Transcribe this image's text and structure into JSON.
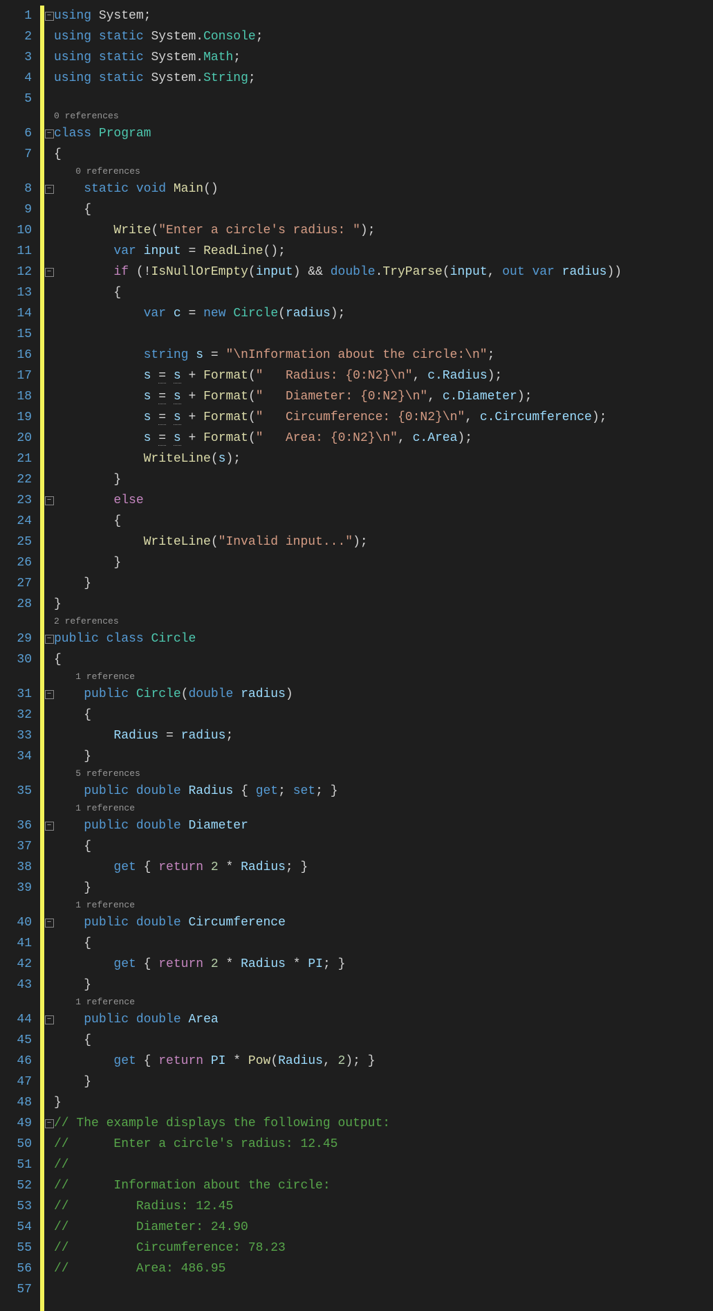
{
  "line_numbers": [
    "1",
    "2",
    "3",
    "4",
    "5",
    "",
    "6",
    "7",
    "",
    "8",
    "9",
    "10",
    "11",
    "12",
    "13",
    "14",
    "15",
    "16",
    "17",
    "18",
    "19",
    "20",
    "21",
    "22",
    "23",
    "24",
    "25",
    "26",
    "27",
    "28",
    "",
    "29",
    "30",
    "",
    "31",
    "32",
    "33",
    "34",
    "",
    "35",
    "",
    "36",
    "37",
    "38",
    "39",
    "",
    "40",
    "41",
    "42",
    "43",
    "",
    "44",
    "45",
    "46",
    "47",
    "48",
    "49",
    "50",
    "51",
    "52",
    "53",
    "54",
    "55",
    "56",
    "57"
  ],
  "codelens": {
    "class_program": "0 references",
    "main": "0 references",
    "class_circle": "2 references",
    "ctor": "1 reference",
    "radius_prop": "5 references",
    "diameter": "1 reference",
    "circ": "1 reference",
    "area": "1 reference"
  },
  "fold_markers": {
    "l1": "−",
    "l6": "−",
    "l8": "−",
    "l12": "−",
    "l23": "−",
    "l29": "−",
    "l31": "−",
    "l36": "−",
    "l40": "−",
    "l44": "−",
    "l49": "−"
  },
  "code": {
    "l1": {
      "kw1": "using",
      "sp1": " ",
      "ns1": "System",
      "semi": ";"
    },
    "l2": {
      "kw1": "using",
      "sp1": " ",
      "kw2": "static",
      "sp2": " ",
      "ns1": "System.",
      "cls": "Console",
      "semi": ";"
    },
    "l3": {
      "kw1": "using",
      "sp1": " ",
      "kw2": "static",
      "sp2": " ",
      "ns1": "System.",
      "cls": "Math",
      "semi": ";"
    },
    "l4": {
      "kw1": "using",
      "sp1": " ",
      "kw2": "static",
      "sp2": " ",
      "ns1": "System.",
      "cls": "String",
      "semi": ";"
    },
    "l6": {
      "kw1": "class",
      "sp1": " ",
      "cls": "Program"
    },
    "l7": {
      "brace": "{"
    },
    "l8": {
      "indent": "    ",
      "kw1": "static",
      "sp1": " ",
      "kw2": "void",
      "sp2": " ",
      "fn": "Main",
      "paren": "()"
    },
    "l9": {
      "indent": "    ",
      "brace": "{"
    },
    "l10": {
      "indent": "        ",
      "fn": "Write",
      "p1": "(",
      "str": "\"Enter a circle's radius: \"",
      "p2": ");"
    },
    "l11": {
      "indent": "        ",
      "kw1": "var",
      "sp1": " ",
      "var": "input",
      "sp2": " ",
      "op": "=",
      "sp3": " ",
      "fn": "ReadLine",
      "tail": "();"
    },
    "l12": {
      "indent": "        ",
      "ctrl": "if",
      "sp1": " ",
      "p1": "(!",
      "fn1": "IsNullOrEmpty",
      "p2": "(",
      "var1": "input",
      "p3": ") ",
      "op": "&&",
      "sp2": " ",
      "kw1": "double",
      "dot": ".",
      "fn2": "TryParse",
      "p4": "(",
      "var2": "input",
      "c1": ", ",
      "kw2": "out",
      "sp3": " ",
      "kw3": "var",
      "sp4": " ",
      "var3": "radius",
      "p5": "))"
    },
    "l13": {
      "indent": "        ",
      "brace": "{"
    },
    "l14": {
      "indent": "            ",
      "kw1": "var",
      "sp1": " ",
      "var": "c",
      "sp2": " ",
      "op": "=",
      "sp3": " ",
      "kw2": "new",
      "sp4": " ",
      "cls": "Circle",
      "p1": "(",
      "var2": "radius",
      "p2": ");"
    },
    "l16": {
      "indent": "            ",
      "kw1": "string",
      "sp1": " ",
      "var": "s",
      "sp2": " ",
      "op": "=",
      "sp3": " ",
      "str": "\"\\nInformation about the circle:\\n\"",
      "semi": ";"
    },
    "l17": {
      "indent": "            ",
      "var": "s",
      "sp1": " ",
      "op": "=",
      "sp2": " ",
      "var2": "s",
      "sp3": " ",
      "op2": "+",
      "sp4": " ",
      "fn": "Format",
      "p1": "(",
      "str": "\"   Radius: {0:N2}\\n\"",
      "c": ", ",
      "var3": "c.Radius",
      "p2": ");"
    },
    "l18": {
      "indent": "            ",
      "var": "s",
      "sp1": " ",
      "op": "=",
      "sp2": " ",
      "var2": "s",
      "sp3": " ",
      "op2": "+",
      "sp4": " ",
      "fn": "Format",
      "p1": "(",
      "str": "\"   Diameter: {0:N2}\\n\"",
      "c": ", ",
      "var3": "c.Diameter",
      "p2": ");"
    },
    "l19": {
      "indent": "            ",
      "var": "s",
      "sp1": " ",
      "op": "=",
      "sp2": " ",
      "var2": "s",
      "sp3": " ",
      "op2": "+",
      "sp4": " ",
      "fn": "Format",
      "p1": "(",
      "str": "\"   Circumference: {0:N2}\\n\"",
      "c": ", ",
      "var3": "c.Circumference",
      "p2": ");"
    },
    "l20": {
      "indent": "            ",
      "var": "s",
      "sp1": " ",
      "op": "=",
      "sp2": " ",
      "var2": "s",
      "sp3": " ",
      "op2": "+",
      "sp4": " ",
      "fn": "Format",
      "p1": "(",
      "str": "\"   Area: {0:N2}\\n\"",
      "c": ", ",
      "var3": "c.Area",
      "p2": ");"
    },
    "l21": {
      "indent": "            ",
      "fn": "WriteLine",
      "p1": "(",
      "var": "s",
      "p2": ");"
    },
    "l22": {
      "indent": "        ",
      "brace": "}"
    },
    "l23": {
      "indent": "        ",
      "ctrl": "else"
    },
    "l24": {
      "indent": "        ",
      "brace": "{"
    },
    "l25": {
      "indent": "            ",
      "fn": "WriteLine",
      "p1": "(",
      "str": "\"Invalid input...\"",
      "p2": ");"
    },
    "l26": {
      "indent": "        ",
      "brace": "}"
    },
    "l27": {
      "indent": "    ",
      "brace": "}"
    },
    "l28": {
      "brace": "}"
    },
    "l29": {
      "kw1": "public",
      "sp1": " ",
      "kw2": "class",
      "sp2": " ",
      "cls": "Circle"
    },
    "l30": {
      "brace": "{"
    },
    "l31": {
      "indent": "    ",
      "kw1": "public",
      "sp1": " ",
      "cls": "Circle",
      "p1": "(",
      "kw2": "double",
      "sp2": " ",
      "var": "radius",
      "p2": ")"
    },
    "l32": {
      "indent": "    ",
      "brace": "{"
    },
    "l33": {
      "indent": "        ",
      "var": "Radius",
      "sp1": " ",
      "op": "=",
      "sp2": " ",
      "var2": "radius",
      "semi": ";"
    },
    "l34": {
      "indent": "    ",
      "brace": "}"
    },
    "l35": {
      "indent": "    ",
      "kw1": "public",
      "sp1": " ",
      "kw2": "double",
      "sp2": " ",
      "var": "Radius",
      "sp3": " { ",
      "kw3": "get",
      "s1": "; ",
      "kw4": "set",
      "s2": "; }"
    },
    "l36": {
      "indent": "    ",
      "kw1": "public",
      "sp1": " ",
      "kw2": "double",
      "sp2": " ",
      "var": "Diameter"
    },
    "l37": {
      "indent": "    ",
      "brace": "{"
    },
    "l38": {
      "indent": "        ",
      "kw1": "get",
      "sp1": " { ",
      "ctrl": "return",
      "sp2": " ",
      "num": "2",
      "sp3": " ",
      "op": "*",
      "sp4": " ",
      "var": "Radius",
      "tail": "; }"
    },
    "l39": {
      "indent": "    ",
      "brace": "}"
    },
    "l40": {
      "indent": "    ",
      "kw1": "public",
      "sp1": " ",
      "kw2": "double",
      "sp2": " ",
      "var": "Circumference"
    },
    "l41": {
      "indent": "    ",
      "brace": "{"
    },
    "l42": {
      "indent": "        ",
      "kw1": "get",
      "sp1": " { ",
      "ctrl": "return",
      "sp2": " ",
      "num": "2",
      "sp3": " ",
      "op": "*",
      "sp4": " ",
      "var": "Radius",
      "sp5": " ",
      "op2": "*",
      "sp6": " ",
      "var2": "PI",
      "tail": "; }"
    },
    "l43": {
      "indent": "    ",
      "brace": "}"
    },
    "l44": {
      "indent": "    ",
      "kw1": "public",
      "sp1": " ",
      "kw2": "double",
      "sp2": " ",
      "var": "Area"
    },
    "l45": {
      "indent": "    ",
      "brace": "{"
    },
    "l46": {
      "indent": "        ",
      "kw1": "get",
      "sp1": " { ",
      "ctrl": "return",
      "sp2": " ",
      "var": "PI",
      "sp3": " ",
      "op": "*",
      "sp4": " ",
      "fn": "Pow",
      "p1": "(",
      "var2": "Radius",
      "c": ", ",
      "num": "2",
      "p2": "); }"
    },
    "l47": {
      "indent": "    ",
      "brace": "}"
    },
    "l48": {
      "brace": "}"
    },
    "l49": {
      "cmt": "// The example displays the following output:"
    },
    "l50": {
      "cmt": "//      Enter a circle's radius: 12.45"
    },
    "l51": {
      "cmt": "//"
    },
    "l52": {
      "cmt": "//      Information about the circle:"
    },
    "l53": {
      "cmt": "//         Radius: 12.45"
    },
    "l54": {
      "cmt": "//         Diameter: 24.90"
    },
    "l55": {
      "cmt": "//         Circumference: 78.23"
    },
    "l56": {
      "cmt": "//         Area: 486.95"
    }
  }
}
